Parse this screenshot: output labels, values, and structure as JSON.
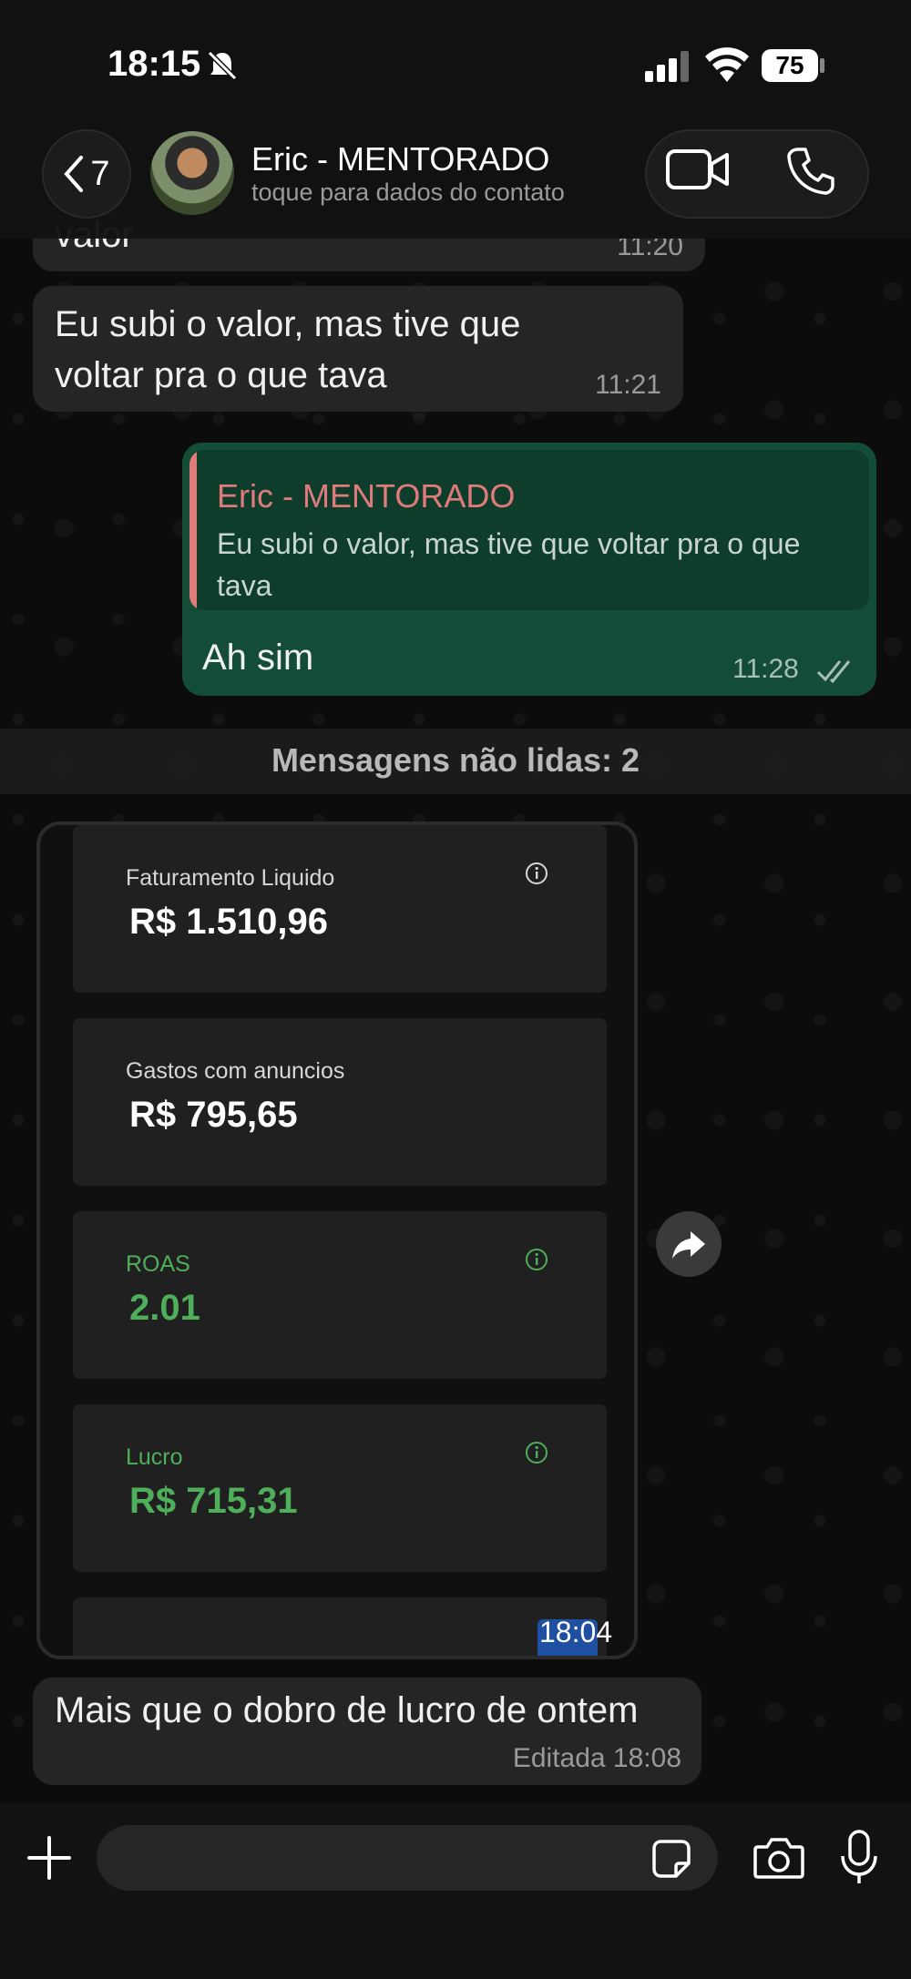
{
  "status_bar": {
    "time": "18:15",
    "battery": "75"
  },
  "header": {
    "back_count": "7",
    "contact_name": "Eric - MENTORADO",
    "contact_subtitle": "toque para dados do contato",
    "icons": [
      "chevron-left-icon",
      "video-icon",
      "phone-icon"
    ]
  },
  "messages": [
    {
      "direction": "in",
      "text": "valor",
      "time": "11:20"
    },
    {
      "direction": "in",
      "text": "Eu subi o valor, mas tive que voltar pra o que tava",
      "time": "11:21"
    },
    {
      "direction": "out",
      "quote_author": "Eric - MENTORADO",
      "quote_text": "Eu subi o valor, mas tive que voltar pra o que tava",
      "text": "Ah sim",
      "time": "11:28"
    }
  ],
  "unread_divider": "Mensagens não lidas: 2",
  "image_message": {
    "time": "18:04",
    "cards": [
      {
        "label": "Faturamento Liquido",
        "value": "R$ 1.510,96"
      },
      {
        "label": "Gastos com anuncios",
        "value": "R$ 795,65"
      },
      {
        "label": "ROAS",
        "value": "2.01"
      },
      {
        "label": "Lucro",
        "value": "R$ 715,31"
      }
    ]
  },
  "last_message": {
    "text": "Mais que o dobro de lucro de ontem",
    "time": "Editada 18:08"
  },
  "input": {
    "placeholder": ""
  },
  "colors": {
    "outgoing_bubble": "#144d37",
    "incoming_bubble": "#242626",
    "quote_accent": "#e07b7b",
    "positive_green": "#4fae59"
  }
}
